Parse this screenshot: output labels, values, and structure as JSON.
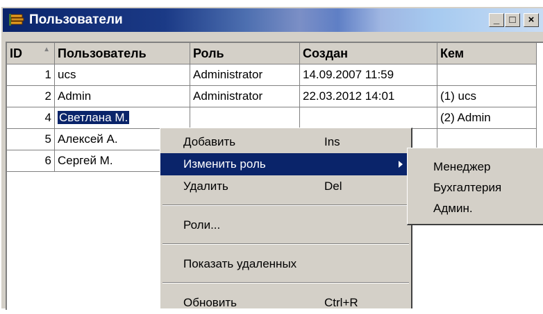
{
  "window": {
    "title": "Пользователи",
    "buttons": {
      "minimize": "_",
      "maximize": "□",
      "close": "×"
    }
  },
  "table": {
    "columns": [
      "ID",
      "Пользователь",
      "Роль",
      "Создан",
      "Кем"
    ],
    "rows": [
      {
        "id": "1",
        "user": "ucs",
        "role": "Administrator",
        "created": "14.09.2007 11:59",
        "by": ""
      },
      {
        "id": "2",
        "user": "Admin",
        "role": "Administrator",
        "created": "22.03.2012 14:01",
        "by": "(1) ucs"
      },
      {
        "id": "4",
        "user": "Светлана М.",
        "role": "",
        "created": "",
        "by": "(2) Admin"
      },
      {
        "id": "5",
        "user": "Алексей А.",
        "role": "",
        "created": "",
        "by": ""
      },
      {
        "id": "6",
        "user": "Сергей М.",
        "role": "",
        "created": "",
        "by": ""
      }
    ]
  },
  "context_menu": {
    "add": {
      "label": "Добавить",
      "shortcut": "Ins"
    },
    "change_role": {
      "label": "Изменить роль"
    },
    "delete": {
      "label": "Удалить",
      "shortcut": "Del"
    },
    "roles": {
      "label": "Роли..."
    },
    "show_deleted": {
      "label": "Показать удаленных"
    },
    "refresh": {
      "label": "Обновить",
      "shortcut": "Ctrl+R"
    }
  },
  "submenu": {
    "items": [
      "Менеджер",
      "Бухгалтерия",
      "Админ."
    ]
  },
  "colors": {
    "titlebar": "#0a246a",
    "selection": "#0a246a",
    "face": "#d4d0c8"
  }
}
